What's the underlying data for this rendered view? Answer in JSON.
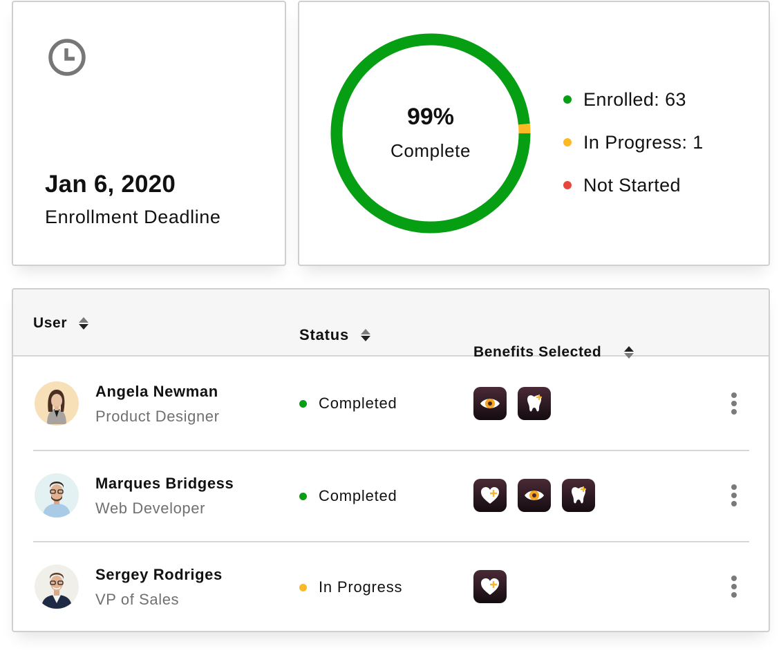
{
  "deadline": {
    "icon": "clock-icon",
    "date": "Jan 6, 2020",
    "label": "Enrollment Deadline"
  },
  "progress": {
    "percent_text": "99%",
    "subtitle": "Complete",
    "colors": {
      "enrolled": "#069e13",
      "in_progress": "#fdb924",
      "not_started": "#e8483b"
    },
    "legend": [
      {
        "key": "enrolled",
        "label": "Enrolled: 63",
        "color": "#069e13"
      },
      {
        "key": "in_progress",
        "label": "In Progress: 1",
        "color": "#fdb924"
      },
      {
        "key": "not_started",
        "label": "Not Started",
        "color": "#e8483b"
      }
    ]
  },
  "chart_data": {
    "type": "pie",
    "variant": "donut",
    "title": "99% Complete",
    "categories": [
      "Enrolled",
      "In Progress",
      "Not Started"
    ],
    "values": [
      63,
      1,
      0
    ],
    "colors": [
      "#069e13",
      "#fdb924",
      "#e8483b"
    ],
    "center_label": "99%",
    "center_sublabel": "Complete",
    "legend_position": "right"
  },
  "table": {
    "columns": [
      {
        "label": "User",
        "sort": "desc"
      },
      {
        "label": "Status",
        "sort": "desc"
      },
      {
        "label": "Benefits Selected",
        "sort": "asc"
      }
    ],
    "rows": [
      {
        "name": "Angela Newman",
        "role": "Product Designer",
        "avatar": "avatar-angela",
        "status": "Completed",
        "status_color": "#069e13",
        "benefits": [
          "vision",
          "dental"
        ]
      },
      {
        "name": "Marques Bridgess",
        "role": "Web Developer",
        "avatar": "avatar-marques",
        "status": "Completed",
        "status_color": "#069e13",
        "benefits": [
          "health",
          "vision",
          "dental"
        ]
      },
      {
        "name": "Sergey Rodriges",
        "role": "VP of Sales",
        "avatar": "avatar-sergey",
        "status": "In Progress",
        "status_color": "#fdb924",
        "benefits": [
          "health"
        ]
      }
    ],
    "row_action_icon": "more-vertical-icon"
  },
  "benefit_icons": {
    "vision": "eye-icon",
    "dental": "tooth-icon",
    "health": "heart-plus-icon"
  },
  "accent_color": "#fdb924"
}
